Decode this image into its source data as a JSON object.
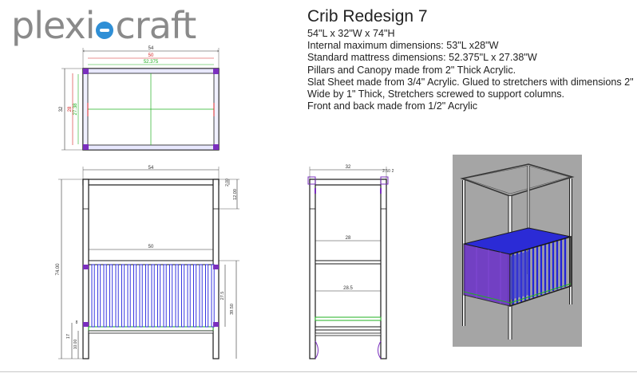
{
  "brand": {
    "left": "plexi",
    "right": "craft"
  },
  "title": "Crib Redesign 7",
  "specs": [
    "54\"L x 32\"W x 74\"H",
    "Internal maximum dimensions: 53\"L x28\"W",
    "Standard mattress dimensions:   52.375\"L x 27.38\"W",
    "Pillars and Canopy made from 2\" Thick Acrylic.",
    "Slat Sheet made from 3/4\" Acrylic. Glued to stretchers  with dimensions 2\" Wide by 1\" Thick, Stretchers screwed to support columns.",
    "Front and back made from 1/2\" Acrylic"
  ],
  "dims": {
    "top_total": "54",
    "top_internal": "50",
    "top_mattress": "52.375",
    "top_depth": "32",
    "top_depth_a": "28",
    "top_depth_b": "27.38",
    "front_width": "54",
    "front_inner": "50",
    "front_height": "74.00",
    "front_canopy": "12.00",
    "front_top_gap": "2.00",
    "front_side_h": "39.50",
    "front_slat_h": "27.5",
    "front_base": "17",
    "front_leg": "10.00",
    "front_stretcher": "8",
    "side_width": "32",
    "side_inner": "28",
    "side_slat": "28.5",
    "side_small_a": "2.50",
    "side_small_b": "2"
  },
  "colors": {
    "frame": "#1a1a1a",
    "slat": "#2222dd",
    "accent": "#7b2fbf",
    "green": "#21b021",
    "red": "#d42222",
    "dim": "#333333",
    "render_bg": "#a5a5a5"
  }
}
